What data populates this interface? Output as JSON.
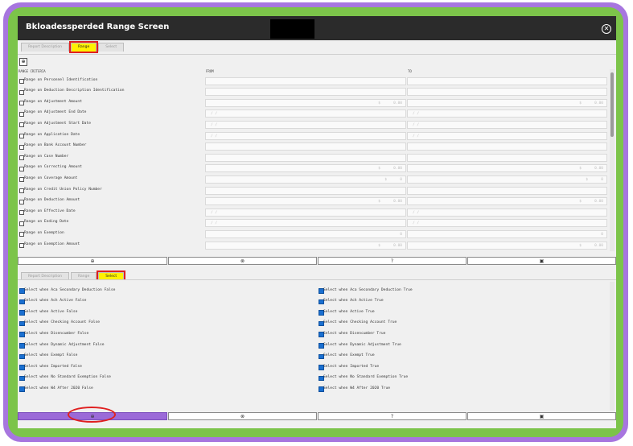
{
  "window": {
    "title": "Bkloadessperded Range Screen"
  },
  "tabs_top": [
    {
      "label": "Report Description",
      "active": false
    },
    {
      "label": "Range",
      "active": true
    },
    {
      "label": "Select",
      "active": false
    }
  ],
  "tabs_bottom": [
    {
      "label": "Report Description",
      "active": false
    },
    {
      "label": "Range",
      "active": false
    },
    {
      "label": "Select",
      "active": true
    }
  ],
  "range": {
    "header_criteria": "RANGE CRITERIA",
    "header_from": "FROM",
    "header_to": "TO",
    "rows": [
      {
        "label": "Range on Personnel Identification",
        "from": "",
        "to": ""
      },
      {
        "label": "Range on Deduction Description Identification",
        "from": "",
        "to": ""
      },
      {
        "label": "Range on Adjustment Amount",
        "from": "$      0.00",
        "to": "$      0.00"
      },
      {
        "label": "Range on Adjustment End Date",
        "from": "/ /",
        "to": "/ /"
      },
      {
        "label": "Range on Adjustment Start Date",
        "from": "/ /",
        "to": "/ /"
      },
      {
        "label": "Range on Application Date",
        "from": "/ /",
        "to": "/ /"
      },
      {
        "label": "Range on Bank Account Number",
        "from": "",
        "to": ""
      },
      {
        "label": "Range on Case Number",
        "from": "",
        "to": ""
      },
      {
        "label": "Range on Correcting Amount",
        "from": "$      0.00",
        "to": "$      0.00"
      },
      {
        "label": "Range on Coverage Amount",
        "from": "$      0",
        "to": "$      0"
      },
      {
        "label": "Range on Credit Union Policy Number",
        "from": "",
        "to": ""
      },
      {
        "label": "Range on Deduction Amount",
        "from": "$      0.00",
        "to": "$      0.00"
      },
      {
        "label": "Range on Effective Date",
        "from": "/ /",
        "to": "/ /"
      },
      {
        "label": "Range on Ending Date",
        "from": "/ /",
        "to": "/ /"
      },
      {
        "label": "Range on Exemption",
        "from": "0",
        "to": "0"
      },
      {
        "label": "Range on Exemption Amount",
        "from": "$      0.00",
        "to": "$      0.00"
      }
    ]
  },
  "action_icons": [
    "plus-circle-icon",
    "close-circle-icon",
    "help-circle-icon",
    "save-icon"
  ],
  "action_glyphs": [
    "⊕",
    "⊗",
    "?",
    "▣"
  ],
  "select": {
    "left": [
      "Select when Aca Secondary Deduction False",
      "Select when Ach Active False",
      "Select when Active False",
      "Select when Checking Account False",
      "Select when Disencumber False",
      "Select when Dynamic Adjustment False",
      "Select when Exempt False",
      "Select when Imported False",
      "Select when No Standard Exemption False",
      "Select when W4 After 2020 False"
    ],
    "right": [
      "Select when Aca Secondary Deduction True",
      "Select when Ach Active True",
      "Select when Active True",
      "Select when Checking Account True",
      "Select when Disencumber True",
      "Select when Dynamic Adjustment True",
      "Select when Exempt True",
      "Select when Imported True",
      "Select when No Standard Exemption True",
      "Select when W4 After 2020 True"
    ]
  },
  "colors": {
    "accent_purple": "#a776df",
    "accent_green": "#7cc44a",
    "active_tab": "#fff200",
    "highlight_red": "#e02020"
  }
}
